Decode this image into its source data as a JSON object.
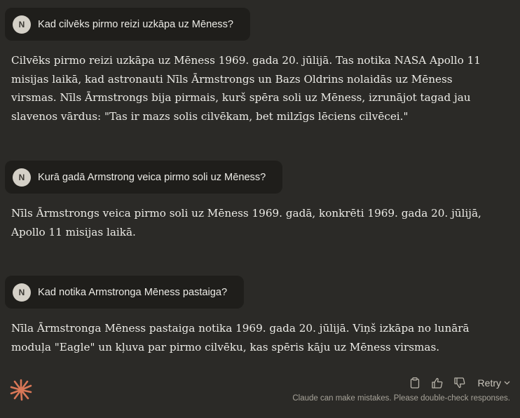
{
  "conversation": [
    {
      "user": {
        "avatar": "N",
        "text": "Kad cilvēks pirmo reizi uzkāpa uz Mēness?"
      },
      "assistant": "Cilvēks pirmo reizi uzkāpa uz Mēness 1969. gada 20. jūlijā. Tas notika NASA Apollo 11 misijas laikā, kad astronauti Nīls Ārmstrongs un Bazs Oldrins nolaidās uz Mēness virsmas. Nīls Ārmstrongs bija pirmais, kurš spēra soli uz Mēness, izrunājot tagad jau slavenos vārdus: \"Tas ir mazs solis cilvēkam, bet milzīgs lēciens cilvēcei.\""
    },
    {
      "user": {
        "avatar": "N",
        "text": "Kurā gadā Armstrong veica pirmo soli uz Mēness?"
      },
      "assistant": "Nīls Ārmstrongs veica pirmo soli uz Mēness 1969. gadā, konkrēti 1969. gada 20. jūlijā, Apollo 11 misijas laikā."
    },
    {
      "user": {
        "avatar": "N",
        "text": "Kad notika Armstronga Mēness pastaiga?"
      },
      "assistant": "Nīla Ārmstronga Mēness pastaiga notika 1969. gada 20. jūlijā. Viņš izkāpa no lunārā moduļa \"Eagle\" un kļuva par pirmo cilvēku, kas spēris kāju uz Mēness virsmas."
    }
  ],
  "footer": {
    "retry_label": "Retry",
    "disclaimer": "Claude can make mistakes. Please double-check responses.",
    "icons": [
      "copy-icon",
      "thumbs-up-icon",
      "thumbs-down-icon",
      "chevron-down-icon"
    ]
  },
  "colors": {
    "background": "#2b2a27",
    "user_bubble": "#1f1e1b",
    "logo_accent": "#d97757",
    "text": "#ecebe6"
  }
}
